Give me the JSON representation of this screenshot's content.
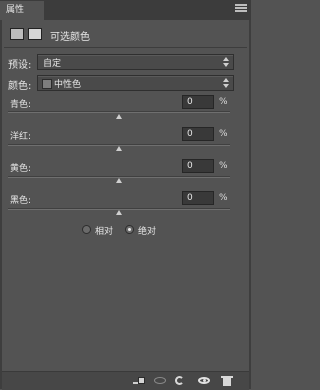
{
  "panel": {
    "tab_label": "属性",
    "title": "可选颜色"
  },
  "preset": {
    "label": "预设:",
    "value": "自定"
  },
  "colors": {
    "label": "颜色:",
    "value": "中性色"
  },
  "sliders": [
    {
      "label": "青色:",
      "value": "0",
      "unit": "%",
      "level": 0.5
    },
    {
      "label": "洋红:",
      "value": "0",
      "unit": "%",
      "level": 0.5
    },
    {
      "label": "黄色:",
      "value": "0",
      "unit": "%",
      "level": 0.5
    },
    {
      "label": "黑色:",
      "value": "0",
      "unit": "%",
      "level": 0.5
    }
  ],
  "method": {
    "options": [
      "相对",
      "绝对"
    ],
    "selected": "绝对"
  },
  "icons": {
    "adjustment": "selective-color-icon",
    "mask": "mask-icon",
    "clip": "clip-to-layer-icon",
    "view_previous": "view-previous-state-icon",
    "reset": "reset-icon",
    "visibility": "visibility-eye-icon",
    "delete": "trash-icon"
  }
}
